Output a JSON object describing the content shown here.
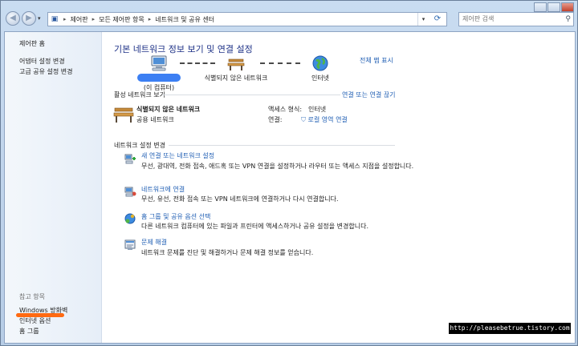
{
  "address": {
    "crumbs": [
      "제어판",
      "모든 제어판 항목",
      "네트워크 및 공유 센터"
    ]
  },
  "search": {
    "placeholder": "제어판 검색"
  },
  "sidebar": {
    "home": "제어판 홈",
    "links": [
      "어댑터 설정 변경",
      "고급 공유 설정 변경"
    ],
    "see_also_label": "참고 항목",
    "see_also": [
      "Windows 방화벽",
      "인터넷 옵션",
      "홈 그룹"
    ]
  },
  "main": {
    "title": "기본 네트워크 정보 보기 및 연결 설정",
    "full_map": "전체 맵 표시",
    "map": {
      "computer": "(이 컴퓨터)",
      "network": "식별되지 않은 네트워크",
      "internet": "인터넷"
    },
    "active": {
      "heading": "활성 네트워크 보기",
      "action": "연결 또는 연결 끊기",
      "network_name": "식별되지 않은 네트워크",
      "network_type": "공용 네트워크",
      "access_label": "액세스 형식:",
      "access_value": "인터넷",
      "conn_label": "연결:",
      "conn_value": "로컬 영역 연결"
    },
    "settings": {
      "heading": "네트워크 설정 변경",
      "tasks": [
        {
          "title": "새 연결 또는 네트워크 설정",
          "desc": "무선, 광대역, 전화 접속, 애드혹 또는 VPN 연결을 설정하거나 라우터 또는 액세스 지점을 설정합니다."
        },
        {
          "title": "네트워크에 연결",
          "desc": "무선, 유선, 전화 접속 또는 VPN 네트워크에 연결하거나 다시 연결합니다."
        },
        {
          "title": "홈 그룹 및 공유 옵션 선택",
          "desc": "다른 네트워크 컴퓨터에 있는 파일과 프린터에 액세스하거나 공유 설정을 변경합니다."
        },
        {
          "title": "문제 해결",
          "desc": "네트워크 문제를 진단 및 해결하거나 문제 해결 정보를 얻습니다."
        }
      ]
    }
  },
  "watermark": "http://pleasebetrue.tistory.com",
  "colors": {
    "link": "#1e5db3",
    "title": "#1e3287",
    "highlight": "#ff6a12",
    "redaction": "#3c7ff3"
  }
}
